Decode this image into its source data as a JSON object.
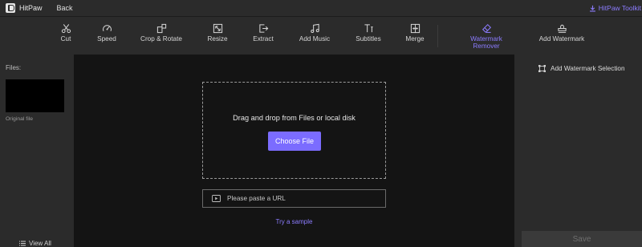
{
  "titlebar": {
    "app_name": "HitPaw",
    "back_label": "Back",
    "toolkit_label": "HitPaw Toolkit",
    "accent_color": "#8c7cff"
  },
  "toolbar": {
    "items": [
      {
        "label": "Cut",
        "icon": "scissors-icon"
      },
      {
        "label": "Speed",
        "icon": "speedometer-icon"
      },
      {
        "label": "Crop & Rotate",
        "icon": "crop-rotate-icon"
      },
      {
        "label": "Resize",
        "icon": "resize-icon"
      },
      {
        "label": "Extract",
        "icon": "extract-icon"
      },
      {
        "label": "Add Music",
        "icon": "music-note-icon"
      },
      {
        "label": "Subtitles",
        "icon": "subtitles-icon"
      },
      {
        "label": "Merge",
        "icon": "merge-icon"
      },
      {
        "label": "Watermark Remover",
        "icon": "eraser-icon",
        "active": true
      },
      {
        "label": "Add Watermark",
        "icon": "stamp-icon"
      }
    ]
  },
  "left_panel": {
    "files_title": "Files:",
    "thumb_label": "Original file",
    "view_all_label": "View All"
  },
  "center": {
    "drop_text": "Drag and drop from Files or local disk",
    "choose_label": "Choose File",
    "url_placeholder": "Please paste a URL",
    "sample_label": "Try a sample",
    "button_color": "#7b6cff"
  },
  "right_panel": {
    "add_selection_label": "Add Watermark Selection",
    "save_label": "Save"
  }
}
